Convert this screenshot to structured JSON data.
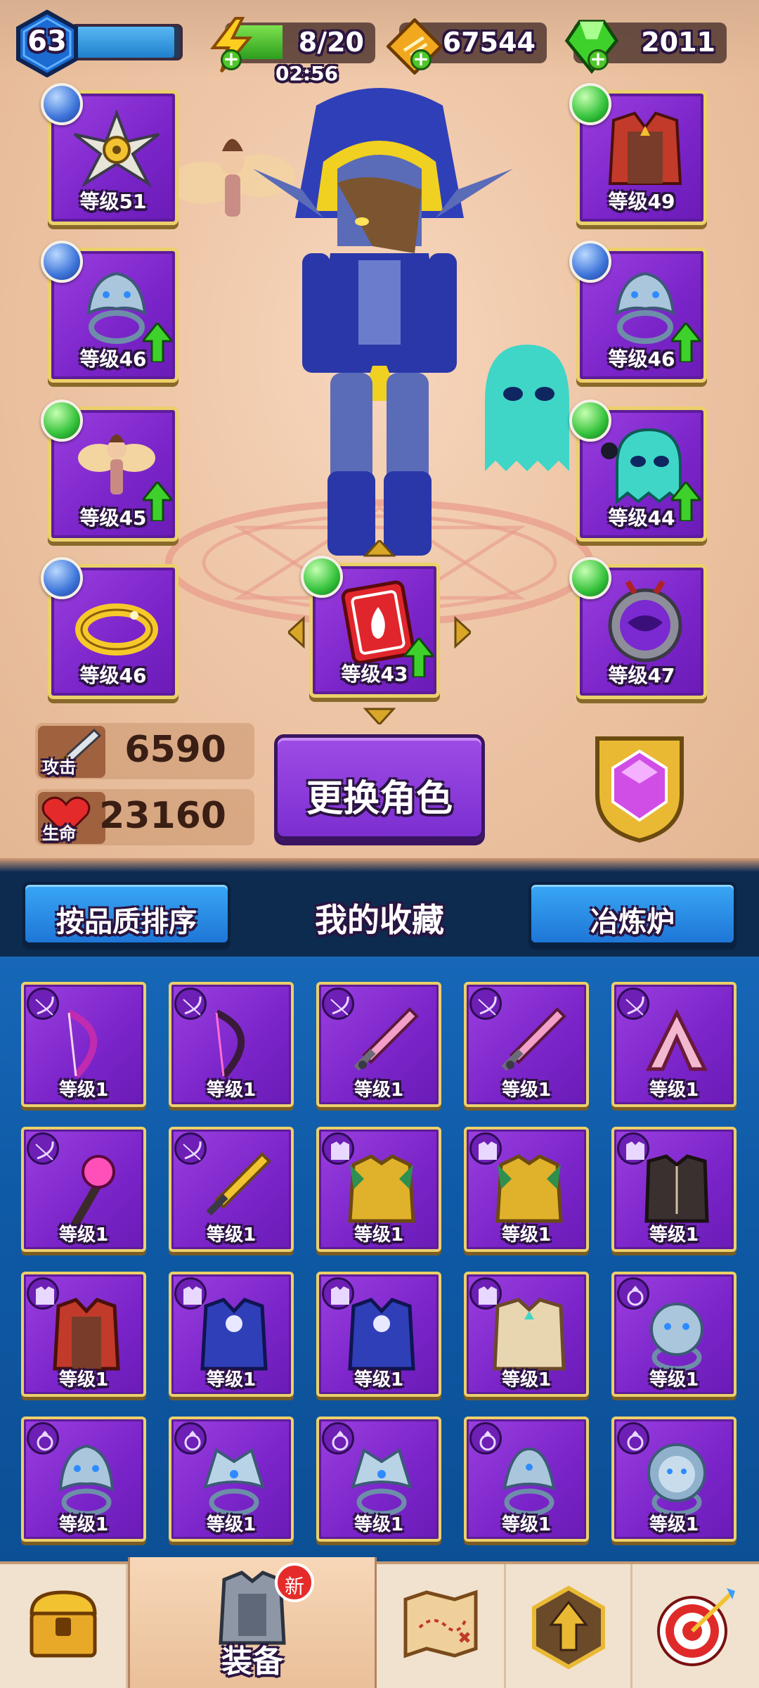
{
  "status": {
    "level": "63",
    "xp_fraction": 0.95,
    "energy": "8/20",
    "energy_fraction": 0.4,
    "energy_timer": "02:56",
    "gold": "67544",
    "gems": "2011"
  },
  "equipped": {
    "slots": [
      {
        "label": "等级51",
        "orb": "blue",
        "item": "shuriken"
      },
      {
        "label": "等级46",
        "orb": "blue",
        "item": "wolf-ring",
        "upgrade": true
      },
      {
        "label": "等级45",
        "orb": "green",
        "item": "fairy",
        "upgrade": true
      },
      {
        "label": "等级46",
        "orb": "blue",
        "item": "gold-bracelet"
      },
      {
        "label": "等级43",
        "orb": "green",
        "item": "fire-spellbook",
        "upgrade": true
      },
      {
        "label": "等级49",
        "orb": "green",
        "item": "red-robe"
      },
      {
        "label": "等级46",
        "orb": "blue",
        "item": "wolf-ring",
        "upgrade": true
      },
      {
        "label": "等级44",
        "orb": "green",
        "item": "ghost-pet",
        "upgrade": true
      },
      {
        "label": "等级47",
        "orb": "green",
        "item": "demon-medallion"
      }
    ]
  },
  "stats": {
    "attack_label": "攻击",
    "attack_value": "6590",
    "hp_label": "生命",
    "hp_value": "23160"
  },
  "actions": {
    "change_character": "更换角色"
  },
  "collection": {
    "sort_button": "按品质排序",
    "title": "我的收藏",
    "smelter_button": "冶炼炉",
    "items": [
      {
        "label": "等级1",
        "type": "weapon",
        "item": "bow-purple"
      },
      {
        "label": "等级1",
        "type": "weapon",
        "item": "bow-dark"
      },
      {
        "label": "等级1",
        "type": "weapon",
        "item": "sword-pink"
      },
      {
        "label": "等级1",
        "type": "weapon",
        "item": "sword-pink"
      },
      {
        "label": "等级1",
        "type": "weapon",
        "item": "boomerang"
      },
      {
        "label": "等级1",
        "type": "weapon",
        "item": "staff-pink"
      },
      {
        "label": "等级1",
        "type": "weapon",
        "item": "sword-gold"
      },
      {
        "label": "等级1",
        "type": "armor",
        "item": "gold-armor"
      },
      {
        "label": "等级1",
        "type": "armor",
        "item": "gold-armor"
      },
      {
        "label": "等级1",
        "type": "armor",
        "item": "dark-vest"
      },
      {
        "label": "等级1",
        "type": "armor",
        "item": "red-robe"
      },
      {
        "label": "等级1",
        "type": "armor",
        "item": "blue-robe"
      },
      {
        "label": "等级1",
        "type": "armor",
        "item": "blue-robe"
      },
      {
        "label": "等级1",
        "type": "armor",
        "item": "white-armor"
      },
      {
        "label": "等级1",
        "type": "ring",
        "item": "bear-ring"
      },
      {
        "label": "等级1",
        "type": "ring",
        "item": "wolf-ring"
      },
      {
        "label": "等级1",
        "type": "ring",
        "item": "dragon-ring"
      },
      {
        "label": "等级1",
        "type": "ring",
        "item": "dragon-ring"
      },
      {
        "label": "等级1",
        "type": "ring",
        "item": "serpent-ring"
      },
      {
        "label": "等级1",
        "type": "ring",
        "item": "lion-ring"
      }
    ]
  },
  "nav": {
    "items": [
      {
        "icon": "treasure-chest-icon",
        "label": ""
      },
      {
        "icon": "armor-icon",
        "label": "装备",
        "badge": "新",
        "active": true
      },
      {
        "icon": "map-icon",
        "label": ""
      },
      {
        "icon": "upgrade-icon",
        "label": ""
      },
      {
        "icon": "target-icon",
        "label": ""
      }
    ]
  },
  "colors": {
    "slot_purple": "#7a24c9",
    "slot_border": "#ecd06a",
    "button_blue": "#1e76d6",
    "upgrade_green": "#3ed12b",
    "grid_blue": "#0f5aa6"
  }
}
